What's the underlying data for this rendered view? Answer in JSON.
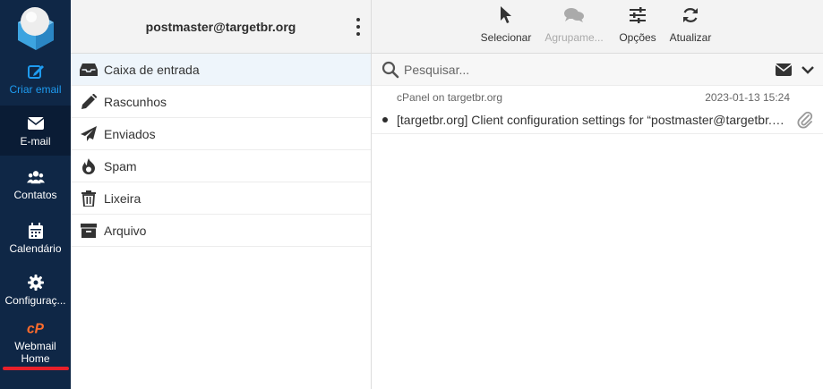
{
  "nav": {
    "items": [
      {
        "label": "Criar email",
        "icon": "compose-icon"
      },
      {
        "label": "E-mail",
        "icon": "envelope-icon"
      },
      {
        "label": "Contatos",
        "icon": "contacts-icon"
      },
      {
        "label": "Calendário",
        "icon": "calendar-icon"
      },
      {
        "label": "Configuraç...",
        "icon": "gear-icon"
      },
      {
        "label": "Webmail Home",
        "icon": "cpanel-icon"
      }
    ],
    "colors": {
      "background": "#0f2746",
      "active": "#0a1c35",
      "compose_accent": "#1e9bf0",
      "cpanel_orange": "#ff6c2c",
      "home_underline": "#e8202a"
    }
  },
  "account": {
    "email": "postmaster@targetbr.org"
  },
  "folders": [
    {
      "label": "Caixa de entrada",
      "icon": "inbox-icon",
      "selected": true
    },
    {
      "label": "Rascunhos",
      "icon": "pencil-icon",
      "selected": false
    },
    {
      "label": "Enviados",
      "icon": "paper-plane-icon",
      "selected": false
    },
    {
      "label": "Spam",
      "icon": "fire-icon",
      "selected": false
    },
    {
      "label": "Lixeira",
      "icon": "trash-icon",
      "selected": false
    },
    {
      "label": "Arquivo",
      "icon": "archive-icon",
      "selected": false
    }
  ],
  "toolbar": {
    "select_label": "Selecionar",
    "group_label": "Agrupame...",
    "options_label": "Opções",
    "refresh_label": "Atualizar"
  },
  "search": {
    "placeholder": "Pesquisar..."
  },
  "messages": [
    {
      "from": "cPanel on targetbr.org",
      "date": "2023-01-13 15:24",
      "subject": "[targetbr.org] Client configuration settings for “postmaster@targetbr.org”",
      "unread": true,
      "has_attachment": true
    }
  ]
}
